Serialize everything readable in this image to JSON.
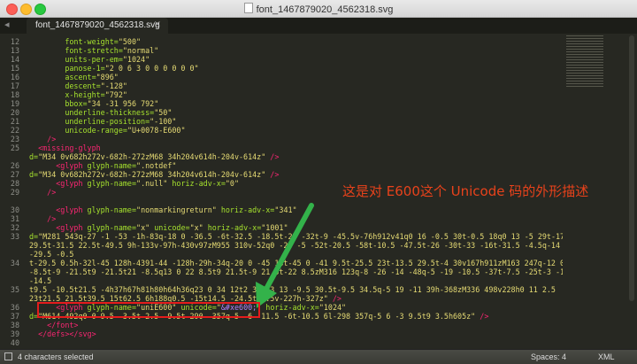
{
  "window": {
    "title": "font_1467879020_4562318.svg"
  },
  "tab": {
    "label": "font_1467879020_4562318.svg",
    "close": "×",
    "nav_arrow": "◂"
  },
  "annotation": "这是对 E600这个 Unicode 码的外形描述",
  "lines": [
    {
      "n": "12",
      "tokens": [
        [
          "attr",
          "        font-weight="
        ],
        [
          "str",
          "\"500\""
        ]
      ]
    },
    {
      "n": "13",
      "tokens": [
        [
          "attr",
          "        font-stretch="
        ],
        [
          "str",
          "\"normal\""
        ]
      ]
    },
    {
      "n": "14",
      "tokens": [
        [
          "attr",
          "        units-per-em="
        ],
        [
          "str",
          "\"1024\""
        ]
      ]
    },
    {
      "n": "15",
      "tokens": [
        [
          "attr",
          "        panose-1="
        ],
        [
          "str",
          "\"2 0 6 3 0 0 0 0 0 0\""
        ]
      ]
    },
    {
      "n": "16",
      "tokens": [
        [
          "attr",
          "        ascent="
        ],
        [
          "str",
          "\"896\""
        ]
      ]
    },
    {
      "n": "17",
      "tokens": [
        [
          "attr",
          "        descent="
        ],
        [
          "str",
          "\"-128\""
        ]
      ]
    },
    {
      "n": "18",
      "tokens": [
        [
          "attr",
          "        x-height="
        ],
        [
          "str",
          "\"792\""
        ]
      ]
    },
    {
      "n": "19",
      "tokens": [
        [
          "attr",
          "        bbox="
        ],
        [
          "str",
          "\"34 -31 956 792\""
        ]
      ]
    },
    {
      "n": "20",
      "tokens": [
        [
          "attr",
          "        underline-thickness="
        ],
        [
          "str",
          "\"50\""
        ]
      ]
    },
    {
      "n": "21",
      "tokens": [
        [
          "attr",
          "        underline-position="
        ],
        [
          "str",
          "\"-100\""
        ]
      ]
    },
    {
      "n": "22",
      "tokens": [
        [
          "attr",
          "        unicode-range="
        ],
        [
          "str",
          "\"U+0078-E600\""
        ]
      ]
    },
    {
      "n": "23",
      "tokens": [
        [
          "tag",
          "    />"
        ]
      ]
    },
    {
      "n": "25",
      "tokens": [
        [
          "tag",
          "  <missing-glyph"
        ]
      ]
    },
    {
      "n": "",
      "tokens": [
        [
          "attr",
          "d="
        ],
        [
          "str",
          "\"M34 0v682h272v-682h-272zM68 34h204v614h-204v-614z\""
        ],
        [
          "tag",
          " />"
        ]
      ]
    },
    {
      "n": "26",
      "tokens": [
        [
          "tag",
          "      <glyph"
        ],
        [
          "attr",
          " glyph-name="
        ],
        [
          "str",
          "\".notdef\""
        ]
      ]
    },
    {
      "n": "27",
      "tokens": [
        [
          "attr",
          "d="
        ],
        [
          "str",
          "\"M34 0v682h272v-682h-272zM68 34h204v614h-204v-614z\""
        ],
        [
          "tag",
          " />"
        ]
      ]
    },
    {
      "n": "28",
      "tokens": [
        [
          "tag",
          "      <glyph"
        ],
        [
          "attr",
          " glyph-name="
        ],
        [
          "str",
          "\".null\""
        ],
        [
          "attr",
          " horiz-adv-x="
        ],
        [
          "str",
          "\"0\""
        ]
      ]
    },
    {
      "n": "29",
      "tokens": [
        [
          "tag",
          "    />"
        ]
      ]
    },
    {
      "n": "",
      "tokens": []
    },
    {
      "n": "30",
      "tokens": [
        [
          "tag",
          "      <glyph"
        ],
        [
          "attr",
          " glyph-name="
        ],
        [
          "str",
          "\"nonmarkingreturn\""
        ],
        [
          "attr",
          " horiz-adv-x="
        ],
        [
          "str",
          "\"341\""
        ]
      ]
    },
    {
      "n": "31",
      "tokens": [
        [
          "tag",
          "    />"
        ]
      ]
    },
    {
      "n": "32",
      "tokens": [
        [
          "tag",
          "      <glyph"
        ],
        [
          "attr",
          " glyph-name="
        ],
        [
          "str",
          "\"x\""
        ],
        [
          "attr",
          " unicode="
        ],
        [
          "str",
          "\"x\""
        ],
        [
          "attr",
          " horiz-adv-x="
        ],
        [
          "str",
          "\"1001\""
        ]
      ]
    },
    {
      "n": "33",
      "tokens": [
        [
          "attr",
          "d="
        ],
        [
          "str",
          "\"M281 543q-27 -1 -53 -1h-83q-18 0 -36.5 -6t-32.5 -18.5t-23 -32t-9 -45.5v-76h912v41q0 16 -0.5 30t-0.5 18q0 13 -5 29t-17"
        ]
      ]
    },
    {
      "n": "",
      "tokens": [
        [
          "str",
          "29.5t-31.5 22.5t-49.5 9h-133v-97h-430v97zM955 310v-52q0 -23 -5 -52t-20.5 -58t-10.5 -47.5t-26 -30t-33 -16t-31.5 -4.5q-14 -1"
        ]
      ]
    },
    {
      "n": "",
      "tokens": [
        [
          "str",
          "-29.5 -0.5"
        ]
      ]
    },
    {
      "n": "34",
      "tokens": [
        [
          "str",
          "t-29.5 0.5h-32l-45 128h-4391-44 -128h-29h-34q-20 0 -45 14t-45 0 -41 9.5t-25.5 23t-13.5 29.5t-4 30v167h911zM163 247q-12 0 -21"
        ]
      ]
    },
    {
      "n": "",
      "tokens": [
        [
          "str",
          "-8.5t-9 -21.5t9 -21.5t21 -8.5q13 0 22 8.5t9 21.5t-9 21.5t-22 8.5zM316 123q-8 -26 -14 -48q-5 -19 -10.5 -37t-7.5 -25t-3 -15t1"
        ]
      ]
    },
    {
      "n": "",
      "tokens": [
        [
          "str",
          "-14.5"
        ]
      ]
    },
    {
      "n": "35",
      "tokens": [
        [
          "str",
          "t9.5 -10.5t21.5 -4h37h67h81h80h64h36q23 0 34 12t2 38q-3 13 -9.5 30.5t-9.5 34.5q-5 19 -11 39h-368zM336 498v228h0 11 2.5"
        ]
      ]
    },
    {
      "n": "",
      "tokens": [
        [
          "str",
          "23t21.5 21.5t39.5 15t62.5 6h188q0.5 -15t14.5 -24.5t22.5v-227h-327z\""
        ],
        [
          "tag",
          " />"
        ]
      ]
    },
    {
      "n": "36",
      "hl": true,
      "tokens": [
        [
          "tag",
          "      <glyph"
        ],
        [
          "attr",
          " glyph-name="
        ],
        [
          "str",
          "\"uniE600\""
        ],
        [
          "attr",
          " unicode="
        ],
        [
          "str",
          "\""
        ],
        [
          "ent",
          "&#xe600;"
        ],
        [
          "str",
          "\""
        ],
        [
          "attr",
          " horiz-adv-x="
        ],
        [
          "str",
          "\"1024\""
        ]
      ]
    },
    {
      "n": "37",
      "tokens": [
        [
          "attr",
          "d="
        ],
        [
          "str",
          "\"M614 492q0 0 9.5 -3.5t-2.5 -9.5t-290 -357q-5 -6 -11.5 -6t-10.5 6l-298 357q-5 6 -3 9.5t9 3.5h605z\""
        ],
        [
          "tag",
          " />"
        ]
      ]
    },
    {
      "n": "38",
      "tokens": [
        [
          "tag",
          "    </font>"
        ]
      ]
    },
    {
      "n": "39",
      "tokens": [
        [
          "tag",
          "  </defs></svg>"
        ]
      ]
    },
    {
      "n": "40",
      "tokens": []
    }
  ],
  "status": {
    "selection": "4 characters selected",
    "spaces": "Spaces: 4",
    "syntax": "XML"
  },
  "colors": {
    "accent_annotation": "#e8421b",
    "arrow": "#33b24a",
    "highlight_box": "#e41c1c"
  }
}
